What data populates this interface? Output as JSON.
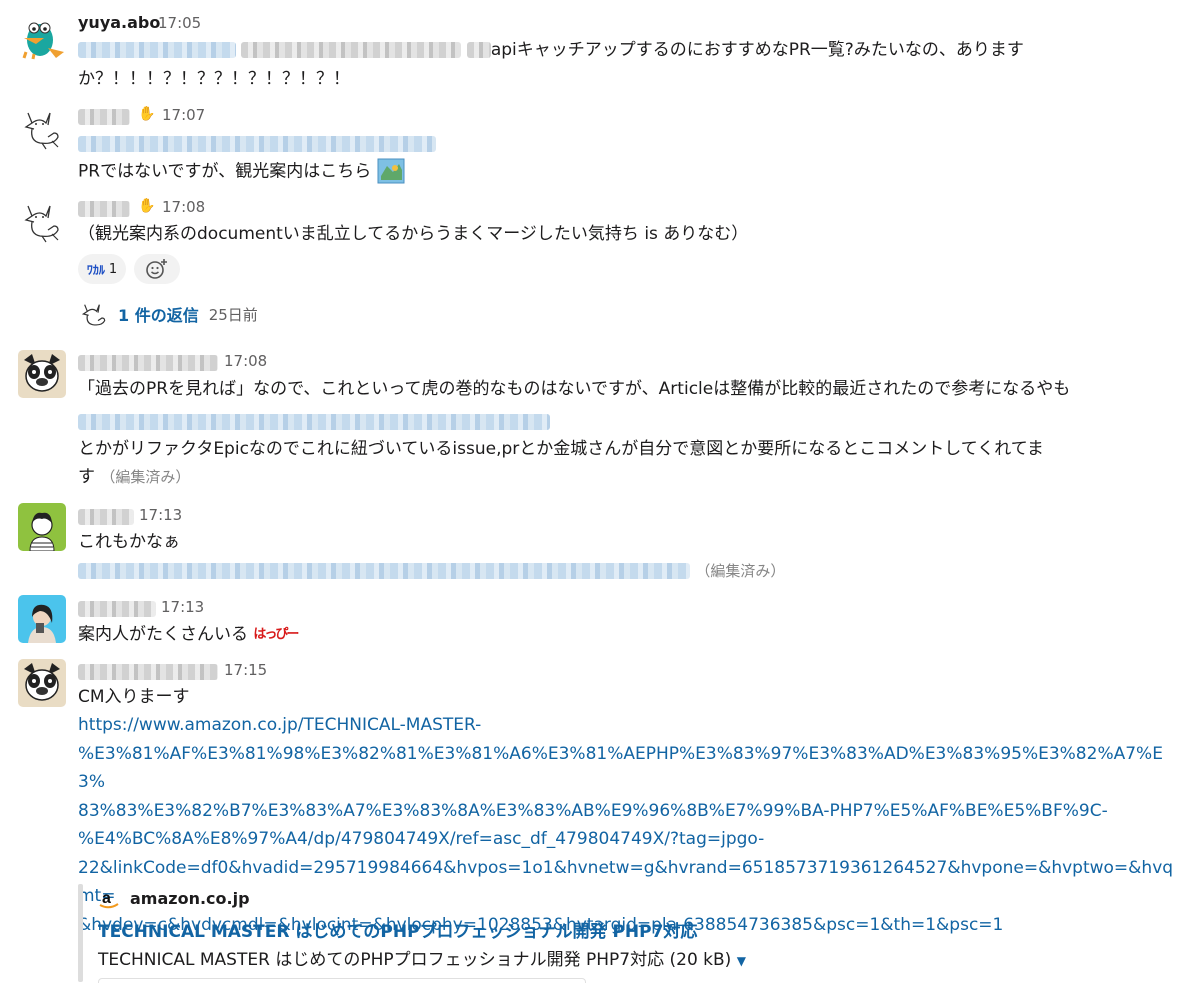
{
  "messages": [
    {
      "author": "yuya.abo",
      "time": "17:05",
      "text1": "apiキャッチアップするのにおすすめなPR一覧?みたいなの、あります",
      "text2": "か？！！！？！？？！？！？！？！"
    },
    {
      "time": "17:07",
      "text": "PRではないですが、観光案内はこちら"
    },
    {
      "time": "17:08",
      "text": "（観光案内系のdocumentいま乱立してるからうまくマージしたい気持ち is ありなむ）",
      "reaction_emoji": "ﾜｶﾙ",
      "reaction_count": "1",
      "thread_replies": "1 件の返信",
      "thread_age": "25日前"
    },
    {
      "time": "17:08",
      "text1": "「過去のPRを見れば」なので、これといって虎の巻的なものはないですが、Articleは整備が比較的最近されたので参考になるやも",
      "text2": "とかがリファクタEpicなのでこれに紐づいているissue,prとか金城さんが自分で意図とか要所になるとこコメントしてくれてま",
      "text3": "す",
      "edited": "（編集済み）"
    },
    {
      "time": "17:13",
      "text": "これもかなぁ",
      "edited": "（編集済み）"
    },
    {
      "time": "17:13",
      "text": "案内人がたくさんいる",
      "emoji": "はっぴー"
    },
    {
      "time": "17:15",
      "text": "CM入りまーす",
      "url": "https://www.amazon.co.jp/TECHNICAL-MASTER-%E3%81%AF%E3%81%98%E3%82%81%E3%81%A6%E3%81%AEPHP%E3%83%97%E3%83%AD%E3%83%95%E3%82%A7%E3%83%83%E3%82%B7%E3%83%A7%E3%83%8A%E3%83%AB%E9%96%8B%E7%99%BA-PHP7%E5%AF%BE%E5%BF%9C-%E4%BC%8A%E8%97%A4/dp/479804749X/ref=asc_df_479804749X/?tag=jpgo-22&linkCode=df0&hvadid=295719984664&hvpos=1o1&hvnetw=g&hvrand=6518573719361264527&hvpone=&hvptwo=&hvqmt=&hvdev=c&hvdvcmdl=&hvlocint=&hvlocphy=1028853&hvtargid=pla-638854736385&psc=1&th=1&psc=1",
      "url_lines": [
        "https://www.amazon.co.jp/TECHNICAL-MASTER-",
        "%E3%81%AF%E3%81%98%E3%82%81%E3%81%A6%E3%81%AEPHP%E3%83%97%E3%83%AD%E3%83%95%E3%82%A7%E3%",
        "83%83%E3%82%B7%E3%83%A7%E3%83%8A%E3%83%AB%E9%96%8B%E7%99%BA-PHP7%E5%AF%BE%E5%BF%9C-",
        "%E4%BC%8A%E8%97%A4/dp/479804749X/ref=asc_df_479804749X/?tag=jpgo-",
        "22&linkCode=df0&hvadid=295719984664&hvpos=1o1&hvnetw=g&hvrand=6518573719361264527&hvpone=&hvptwo=&hvqmt=",
        "&hvdev=c&hvdvcmdl=&hvlocint=&hvlocphy=1028853&hvtargid=pla-638854736385&psc=1&th=1&psc=1"
      ],
      "preview": {
        "site": "amazon.co.jp",
        "title": "TECHNICAL MASTER はじめてのPHPプロフェッショナル開発 PHP7対応",
        "desc": "TECHNICAL MASTER はじめてのPHPプロフェッショナル開発 PHP7対応 (20 kB)"
      }
    }
  ],
  "colors": {
    "link": "#1264a3",
    "text": "#1d1c1d",
    "muted": "#616061"
  }
}
